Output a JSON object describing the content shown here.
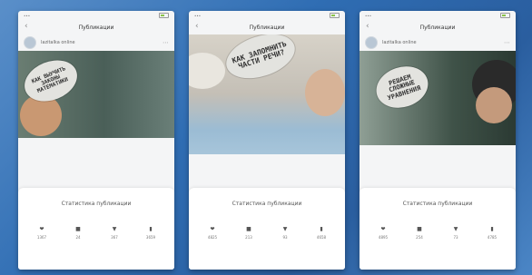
{
  "phones": [
    {
      "nav_title": "Публикации",
      "author": "lazitalka online",
      "bubble": "КАК ВЫУЧИТЬ ЗАКОНЫ МАТЕМАТИКИ",
      "panel_title": "Статистика публикации",
      "stats": [
        {
          "icon": "heart-icon",
          "glyph": "❤",
          "value": "1367"
        },
        {
          "icon": "comment-icon",
          "glyph": "■",
          "value": "24"
        },
        {
          "icon": "reach-icon",
          "glyph": "▼",
          "value": "367"
        },
        {
          "icon": "bookmark-icon",
          "glyph": "▮",
          "value": "3659"
        }
      ]
    },
    {
      "nav_title": "Публикации",
      "author": "",
      "bubble": "КАК ЗАПОМНИТЬ ЧАСТИ РЕЧИ?",
      "panel_title": "Статистика публикации",
      "stats": [
        {
          "icon": "heart-icon",
          "glyph": "❤",
          "value": "4825"
        },
        {
          "icon": "comment-icon",
          "glyph": "■",
          "value": "213"
        },
        {
          "icon": "reach-icon",
          "glyph": "▼",
          "value": "93"
        },
        {
          "icon": "bookmark-icon",
          "glyph": "▮",
          "value": "4658"
        }
      ]
    },
    {
      "nav_title": "Публикации",
      "author": "lazitalka online",
      "bubble": "РЕШАЕМ СЛОЖНЫЕ УРАВНЕНИЯ",
      "panel_title": "Статистика публикации",
      "stats": [
        {
          "icon": "heart-icon",
          "glyph": "❤",
          "value": "4895"
        },
        {
          "icon": "comment-icon",
          "glyph": "■",
          "value": "254"
        },
        {
          "icon": "reach-icon",
          "glyph": "▼",
          "value": "73"
        },
        {
          "icon": "bookmark-icon",
          "glyph": "▮",
          "value": "4785"
        }
      ]
    }
  ],
  "colors": {
    "background": "#2f6db3",
    "panel": "#ffffff",
    "screen": "#f4f5f6"
  }
}
